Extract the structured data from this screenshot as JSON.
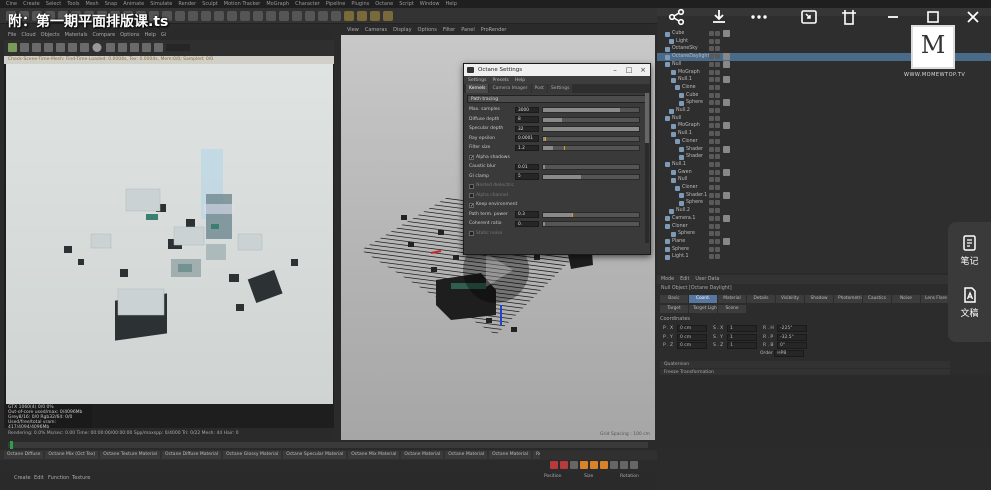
{
  "video_title": "附：第一期平面排版课.ts",
  "watermark": {
    "letter": "M",
    "url": "WWW.MOMEWTOP.TV"
  },
  "menubar": [
    "Cine",
    "Create",
    "Select",
    "Tools",
    "Mesh",
    "Snap",
    "Animate",
    "Simulate",
    "Render",
    "Sculpt",
    "Motion Tracker",
    "MoGraph",
    "Character",
    "Pipeline",
    "Plugins",
    "Octane",
    "Script",
    "Window",
    "Help"
  ],
  "left_viewport": {
    "menu": [
      "File",
      "Cloud",
      "Objects",
      "Materials",
      "Compare",
      "Options",
      "Help",
      "Gi"
    ],
    "status": "Check-Scene-Time-Mesh: Find-Time-Loaded: 0.0004s, Tex: 0.0004s, Mem:0/0; Sampled: 0/0",
    "stats": [
      "GTX 1060(4) 0/0 0%",
      "Out-of-core used/max: 0/4096Mb",
      "Grey8/16: 0/0       Rgb32/64: 0/0",
      "Used/free/total vram: 417/4094/4096Mb"
    ],
    "bottom": "Rendering: 0.0%   Ms/sec: 0.00   Time: 00:00:00/00:00:00   Spp/maxspp: 0/4000   Tri: 0/22   Mesh: 44   Hair: 0"
  },
  "center_viewport": {
    "menu": [
      "View",
      "Cameras",
      "Display",
      "Options",
      "Filter",
      "Panel",
      "ProRender"
    ],
    "grid_note": "Grid Spacing : 100 cm"
  },
  "octane_settings": {
    "title": "Octane Settings",
    "menu": [
      "Settings",
      "Presets",
      "Help"
    ],
    "tabs": [
      "Kernels",
      "Camera Imager",
      "Post",
      "Settings"
    ],
    "kernel": "Path tracing",
    "rows": [
      {
        "label": "Max. samples",
        "value": "3000",
        "fill": 0.8,
        "tick": null
      },
      {
        "label": "Diffuse depth",
        "value": "8",
        "fill": 0.2,
        "tick": null
      },
      {
        "label": "Specular depth",
        "value": "32",
        "fill": 1.0,
        "tick": null
      },
      {
        "label": "Ray epsilon",
        "value": "0.0001",
        "fill": 0.02,
        "tick": 0.02
      },
      {
        "label": "Filter size",
        "value": "1.2",
        "fill": 0.1,
        "tick": 0.22
      }
    ],
    "alpha_shadows": "Alpha shadows",
    "rows2": [
      {
        "label": "Caustic blur",
        "value": "0.01",
        "fill": 0.02,
        "tick": null
      },
      {
        "label": "GI clamp",
        "value": "5",
        "fill": 0.4,
        "tick": null
      }
    ],
    "nested_dielectric": "Nested dielectric",
    "alpha_channel": "Alpha channel",
    "keep_environment": "Keep environment",
    "rows3": [
      {
        "label": "Path term. power",
        "value": "0.3",
        "fill": 0.3,
        "tick": 0.3
      },
      {
        "label": "Coherent ratio",
        "value": "0.",
        "fill": 0.02,
        "tick": null
      }
    ],
    "static_noise": "Static noise"
  },
  "object_manager": {
    "rows": [
      {
        "name": "Cube",
        "indent": 4
      },
      {
        "name": "Light",
        "indent": 8
      },
      {
        "name": "OctaneSky",
        "indent": 4
      },
      {
        "name": "OctaneDaylight",
        "indent": 4
      },
      {
        "name": "Null",
        "indent": 4
      },
      {
        "name": "MoGraph",
        "indent": 10
      },
      {
        "name": "Null.1",
        "indent": 10
      },
      {
        "name": "Clone",
        "indent": 14
      },
      {
        "name": "Cube",
        "indent": 18
      },
      {
        "name": "Sphere",
        "indent": 18
      },
      {
        "name": "Null.2",
        "indent": 8
      },
      {
        "name": "Null",
        "indent": 4
      },
      {
        "name": "MoGraph",
        "indent": 10
      },
      {
        "name": "Null.1",
        "indent": 10
      },
      {
        "name": "Cloner",
        "indent": 14
      },
      {
        "name": "Shader",
        "indent": 18
      },
      {
        "name": "Shader",
        "indent": 18
      },
      {
        "name": "Null.1",
        "indent": 4
      },
      {
        "name": "Gwen",
        "indent": 10
      },
      {
        "name": "Null",
        "indent": 10
      },
      {
        "name": "Cloner",
        "indent": 14
      },
      {
        "name": "Shader.1",
        "indent": 18
      },
      {
        "name": "Sphere",
        "indent": 18
      },
      {
        "name": "Null.2",
        "indent": 8
      },
      {
        "name": "Camera.1",
        "indent": 4
      },
      {
        "name": "Cloner",
        "indent": 4
      },
      {
        "name": "Sphere",
        "indent": 10
      },
      {
        "name": "Plane",
        "indent": 4
      },
      {
        "name": "Sphere",
        "indent": 4
      },
      {
        "name": "Light.1",
        "indent": 4
      }
    ]
  },
  "attribute_manager": {
    "menu": [
      "Mode",
      "Edit",
      "User Data"
    ],
    "subtitle": "Null Object [Octane Daylight]",
    "tabs": [
      "Basic",
      "Coord.",
      "Material",
      "Details",
      "Visibility",
      "Shadow",
      "Photometric",
      "Caustics",
      "Noise",
      "Lens Flare",
      "Project",
      "Target",
      "Target Light Tag",
      "Scene"
    ],
    "active_tab": "Coord.",
    "coords_label": "Coordinates",
    "coord_rows": [
      {
        "axis": "P . X",
        "val": "0 cm",
        "s": "S . X",
        "sv": "1",
        "r": "R . H",
        "rv": "-225°"
      },
      {
        "axis": "P . Y",
        "val": "0 cm",
        "s": "S . Y",
        "sv": "1",
        "r": "R . P",
        "rv": "-32.5°"
      },
      {
        "axis": "P . Z",
        "val": "0 cm",
        "s": "S . Z",
        "sv": "1",
        "r": "R . B",
        "rv": "0°"
      }
    ],
    "order_label": "Order",
    "order_value": "HPB",
    "folds": [
      "Quaternion",
      "Freeze Transformation"
    ]
  },
  "side_buttons": [
    {
      "icon": "note-icon",
      "label": "笔记"
    },
    {
      "icon": "doc-icon",
      "label": "文稿"
    }
  ],
  "materials": [
    "Octane Diffuse",
    "Octane Mix (Oct Tex)",
    "Octane Texture Material",
    "Octane Diffuse Material",
    "Octane Glossy Material",
    "Octane Specular Material",
    "Octane Mix Material",
    "Octane Material",
    "Octane Material",
    "Octane Material",
    "Remove Unused Materials"
  ],
  "bottom_tabs": [
    "Create",
    "Edit",
    "Function",
    "Texture"
  ],
  "bottom_right": {
    "position": "Position",
    "size": "Size",
    "rotation": "Rotation"
  },
  "colors": {
    "accent_yellow": "#d9a020",
    "playhead_green": "#2aa04a",
    "active_tab": "#5577a0"
  }
}
